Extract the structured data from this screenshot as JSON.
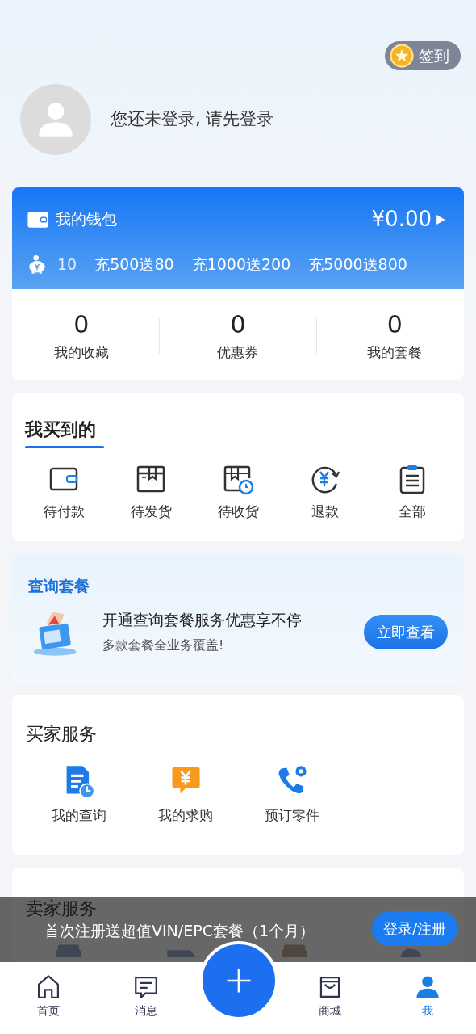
{
  "sign_in": {
    "label": "签到"
  },
  "profile": {
    "prompt": "您还未登录, 请先登录"
  },
  "wallet": {
    "title": "我的钱包",
    "balance": "¥0.00",
    "ticker": "10",
    "promotions": [
      "充500送80",
      "充1000送200",
      "充5000送800"
    ]
  },
  "stats": [
    {
      "value": "0",
      "label": "我的收藏"
    },
    {
      "value": "0",
      "label": "优惠券"
    },
    {
      "value": "0",
      "label": "我的套餐"
    }
  ],
  "purchases": {
    "title": "我买到的",
    "items": [
      {
        "label": "待付款",
        "kind": "wallet"
      },
      {
        "label": "待发货",
        "kind": "box"
      },
      {
        "label": "待收货",
        "kind": "box-clock"
      },
      {
        "label": "退款",
        "kind": "refund"
      },
      {
        "label": "全部",
        "kind": "clipboard"
      }
    ]
  },
  "package": {
    "title": "查询套餐",
    "headline": "开通查询套餐服务优惠享不停",
    "subtitle": "多款套餐全业务覆盖!",
    "button": "立即查看"
  },
  "buyer_services": {
    "title": "买家服务",
    "items": [
      {
        "label": "我的查询",
        "kind": "document-clock"
      },
      {
        "label": "我的求购",
        "kind": "yen-chat"
      },
      {
        "label": "预订零件",
        "kind": "phone-gear"
      }
    ]
  },
  "seller_services": {
    "title": "卖家服务"
  },
  "register_banner": {
    "text": "首次注册送超值VIN/EPC套餐（1个月）",
    "button": "登录/注册"
  },
  "tab_bar": [
    {
      "label": "首页",
      "kind": "home",
      "selected": false
    },
    {
      "label": "消息",
      "kind": "message",
      "selected": false
    },
    {
      "kind": "add",
      "selected": false
    },
    {
      "label": "商城",
      "kind": "shop",
      "selected": false
    },
    {
      "label": "我",
      "kind": "person",
      "selected": true
    }
  ]
}
